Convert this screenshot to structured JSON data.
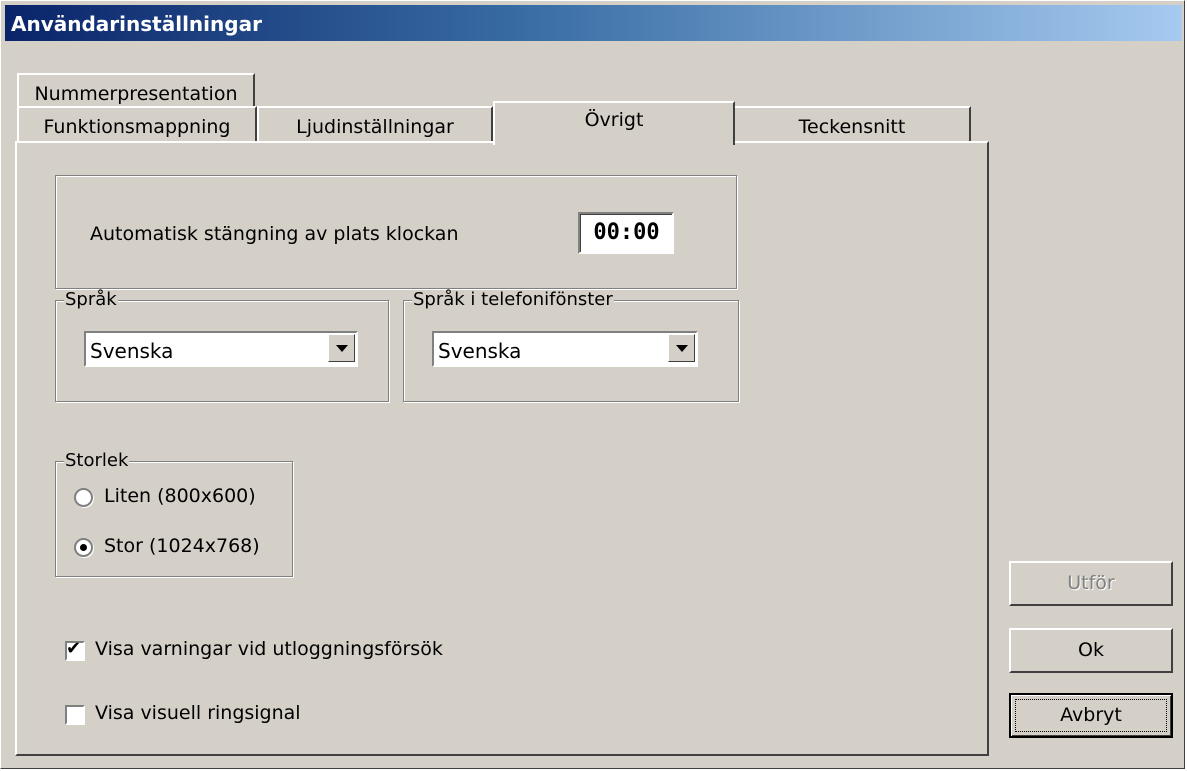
{
  "window": {
    "title": "Användarinställningar"
  },
  "tabs": {
    "row1": [
      {
        "label": "Nummerpresentation"
      }
    ],
    "row2": [
      {
        "label": "Funktionsmappning"
      },
      {
        "label": "Ljudinställningar"
      },
      {
        "label": "Övrigt",
        "selected": true
      },
      {
        "label": "Teckensnitt"
      }
    ]
  },
  "auto_close": {
    "label": "Automatisk stängning av plats klockan",
    "time": "00:00"
  },
  "language": {
    "legend": "Språk",
    "value": "Svenska"
  },
  "phone_language": {
    "legend": "Språk i telefonifönster",
    "value": "Svenska"
  },
  "size": {
    "legend": "Storlek",
    "options": [
      {
        "label": "Liten (800x600)",
        "selected": false
      },
      {
        "label": "Stor (1024x768)",
        "selected": true
      }
    ]
  },
  "checkboxes": [
    {
      "label": "Visa varningar vid utloggningsförsök",
      "checked": true
    },
    {
      "label": "Visa visuell ringsignal",
      "checked": false
    }
  ],
  "buttons": {
    "apply": "Utför",
    "ok": "Ok",
    "cancel": "Avbryt"
  },
  "icons": {
    "checkmark": "✔"
  }
}
